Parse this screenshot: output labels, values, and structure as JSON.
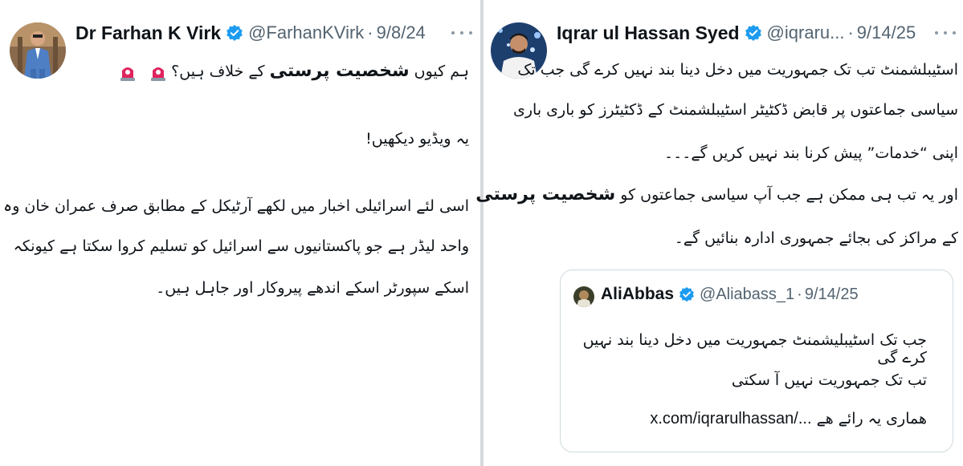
{
  "left_tweet": {
    "author_name": "Dr Farhan K Virk",
    "handle": "@FarhanKVirk",
    "date": "9/8/24",
    "lines": [
      "ہم کیوں",
      "شخصیت پرستی",
      "کے خلاف ہیں؟",
      "یہ ویڈیو دیکھیں!",
      "اسی لئے اسرائیلی اخبار میں لکھے آرٹیکل کے مطابق صرف عمران خان وہ",
      "واحد لیڈر ہے جو پاکستانیوں سے اسرائیل کو تسلیم کروا سکتا ہے کیونکہ",
      "اسکے سپورٹر اسکے اندھے پیروکار اور جاہل ہیں۔"
    ]
  },
  "right_tweet": {
    "author_name": "Iqrar ul Hassan Syed",
    "handle": "@iqraru...",
    "date": "9/14/25",
    "lines": [
      "اسٹیبلشمنٹ تب تک جمہوریت میں دخل دینا بند نہیں کرے گی جب تک",
      "سیاسی جماعتوں پر قابض ڈکٹیٹر اسٹیبلشمنٹ کے ڈکٹیٹرز کو باری باری",
      "اپنی “خدمات” پیش کرنا بند نہیں کریں گے۔۔۔",
      "اور یہ تب ہی ممکن ہے جب آپ سیاسی جماعتوں کو",
      "شخصیت پرستی",
      "کے مراکز کی بجائے جمہوری ادارہ بنائیں گے۔"
    ],
    "quote": {
      "author_name": "AliAbbas",
      "handle": "@Aliabass_1",
      "date": "9/14/25",
      "lines": [
        "جب تک اسٹیبلیشمنٹ جمہوریت میں دخل دینا بند نہیں کرے گی",
        "تب تک جمہوریت نہیں آ سکتی",
        "ھماری یہ رائے ھے",
        "x.com/iqrarulhassan/..."
      ]
    }
  },
  "colors": {
    "verified_blue": "#1d9bf0",
    "muted_text": "#536471",
    "divider": "#d6d9dc",
    "siren_red": "#e0245e"
  }
}
